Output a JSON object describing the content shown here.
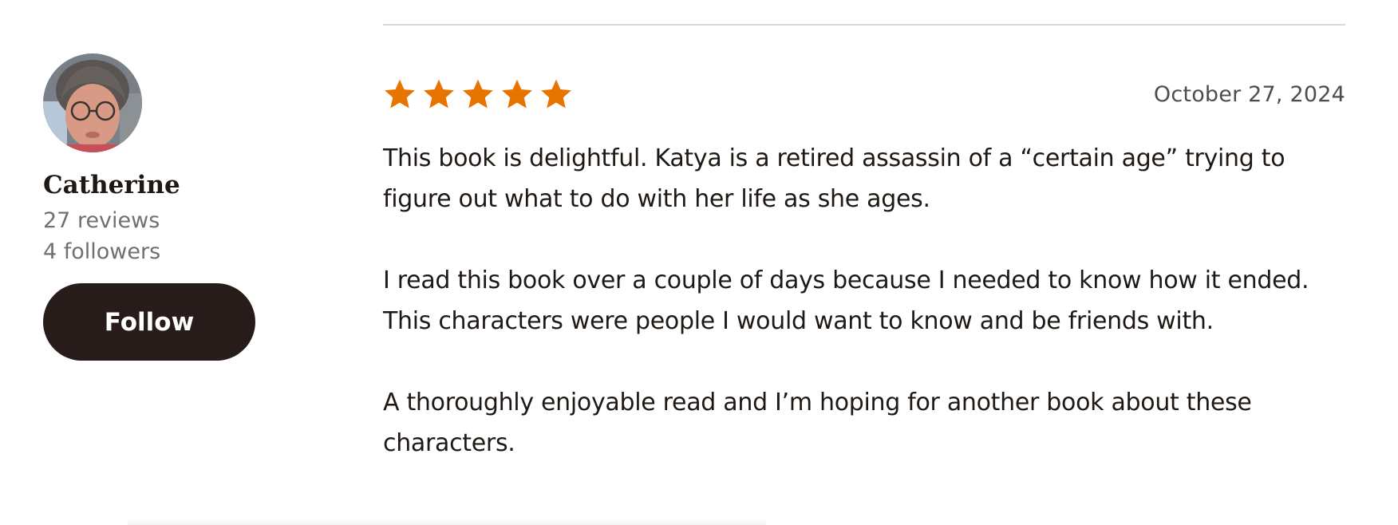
{
  "reviewer": {
    "name": "Catherine",
    "reviews_count": "27 reviews",
    "followers_count": "4 followers",
    "follow_label": "Follow",
    "avatar_icon": "reviewer-photo"
  },
  "review": {
    "rating": 5,
    "rating_max": 5,
    "star_color": "#e87400",
    "date": "October 27, 2024",
    "paragraphs": [
      "This book is delightful. Katya is a retired assassin of a “certain age” trying to figure out what to do with her life as she ages.",
      "I read this book over a couple of days because I needed to know how it ended. This characters were people I would want to know and be friends with.",
      "A thoroughly enjoyable read and I’m hoping for another book about these characters."
    ]
  },
  "colors": {
    "follow_button_bg": "#271c1a",
    "stat_text": "#707070",
    "date_text": "#4d4d4d"
  }
}
